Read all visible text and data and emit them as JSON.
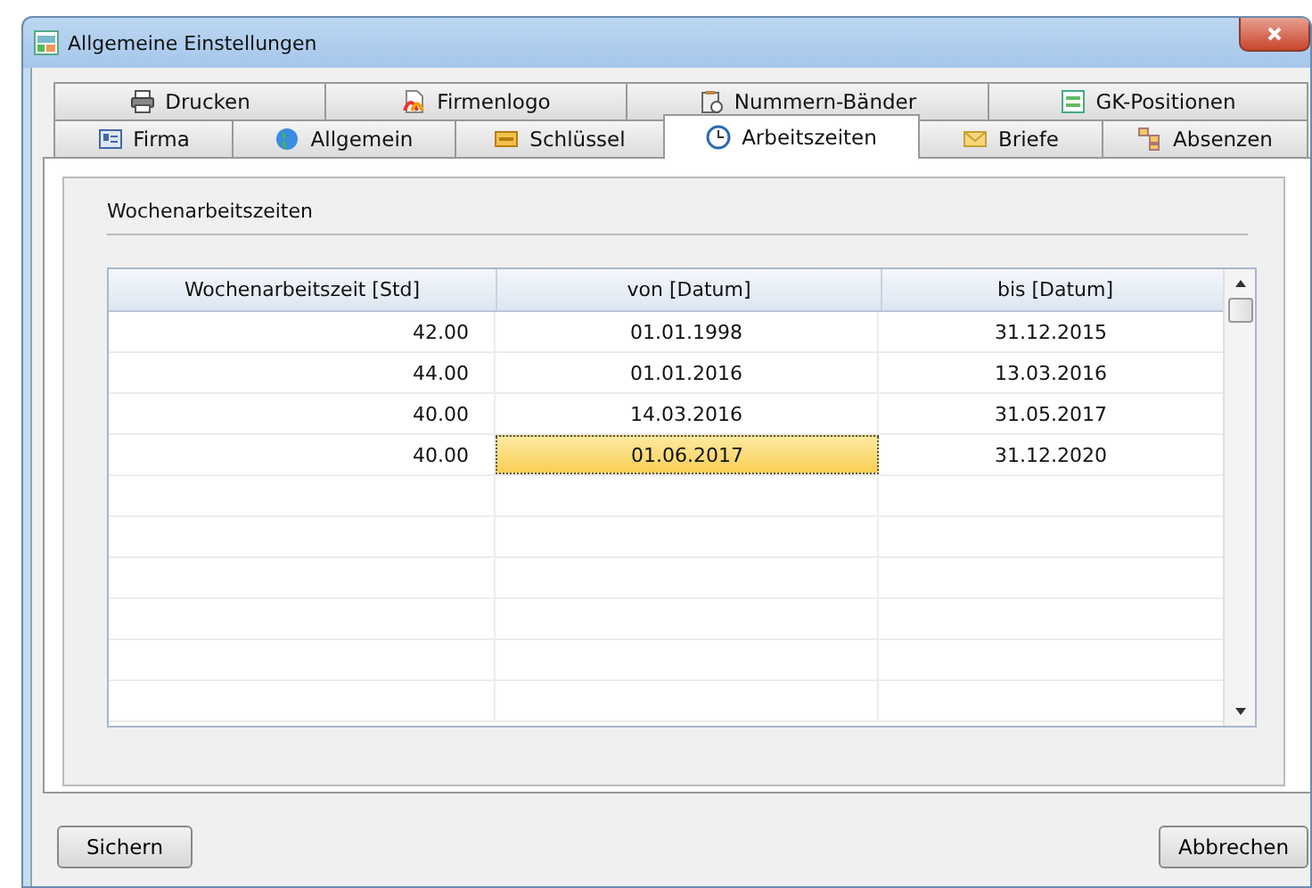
{
  "window": {
    "title": "Allgemeine Einstellungen"
  },
  "tab_rows": [
    [
      {
        "label": "Drucken",
        "selected": false
      },
      {
        "label": "Firmenlogo",
        "selected": false
      },
      {
        "label": "Nummern-Bänder",
        "selected": false
      },
      {
        "label": "GK-Positionen",
        "selected": false
      }
    ],
    [
      {
        "label": "Firma",
        "selected": false
      },
      {
        "label": "Allgemein",
        "selected": false
      },
      {
        "label": "Schlüssel",
        "selected": false
      },
      {
        "label": "Arbeitszeiten",
        "selected": true
      },
      {
        "label": "Briefe",
        "selected": false
      },
      {
        "label": "Absenzen",
        "selected": false
      }
    ]
  ],
  "group": {
    "title": "Wochenarbeitszeiten"
  },
  "table": {
    "columns": [
      "Wochenarbeitszeit [Std]",
      "von [Datum]",
      "bis [Datum]"
    ],
    "rows": [
      {
        "cells": [
          {
            "text": "42.00",
            "selected": false
          },
          {
            "text": "01.01.1998",
            "selected": false
          },
          {
            "text": "31.12.2015",
            "selected": false
          }
        ]
      },
      {
        "cells": [
          {
            "text": "44.00",
            "selected": false
          },
          {
            "text": "01.01.2016",
            "selected": false
          },
          {
            "text": "13.03.2016",
            "selected": false
          }
        ]
      },
      {
        "cells": [
          {
            "text": "40.00",
            "selected": false
          },
          {
            "text": "14.03.2016",
            "selected": false
          },
          {
            "text": "31.05.2017",
            "selected": false
          }
        ]
      },
      {
        "cells": [
          {
            "text": "40.00",
            "selected": false
          },
          {
            "text": "01.06.2017",
            "selected": true
          },
          {
            "text": "31.12.2020",
            "selected": false
          }
        ]
      }
    ]
  },
  "buttons": [
    {
      "label": "Sichern"
    },
    {
      "label": "Abbrechen"
    }
  ]
}
